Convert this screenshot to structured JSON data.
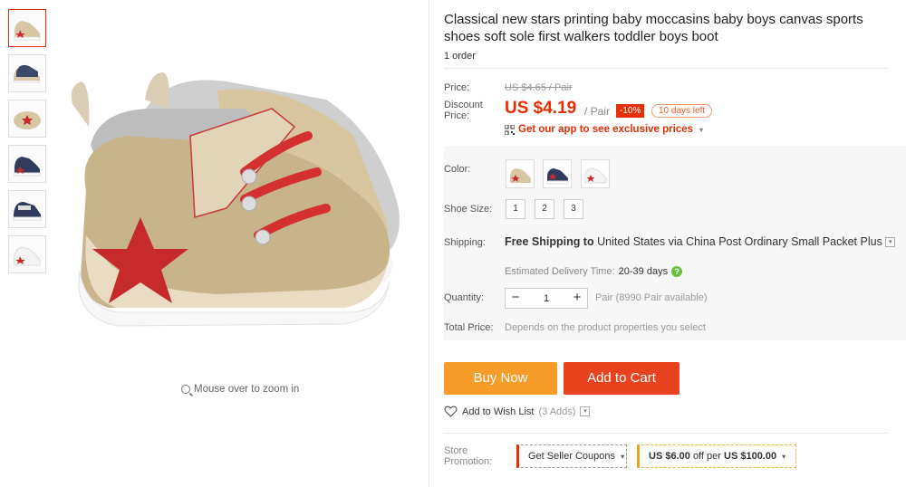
{
  "product": {
    "title": "Classical new stars printing baby moccasins baby boys canvas sports shoes soft sole first walkers toddler boys boot",
    "orders": "1 order"
  },
  "gallery": {
    "zoom_hint": "Mouse over to zoom in",
    "thumbnails": [
      "thumb-1",
      "thumb-2",
      "thumb-3",
      "thumb-4",
      "thumb-5",
      "thumb-6"
    ]
  },
  "price": {
    "label": "Price:",
    "original": "US $4.65 / Pair",
    "discount_label": "Discount Price:",
    "discount_price": "US $4.19",
    "unit": "/ Pair",
    "discount_badge": "-10%",
    "days_left": "10 days left",
    "app_promo": "Get our app to see exclusive prices",
    "app_promo_caret": "▾"
  },
  "options": {
    "color_label": "Color:",
    "size_label": "Shoe Size:",
    "sizes": [
      "1",
      "2",
      "3"
    ]
  },
  "shipping": {
    "label": "Shipping:",
    "free_text": "Free Shipping to",
    "destination": "United States via China Post Ordinary Small Packet Plus",
    "dropdown_glyph": "▾",
    "est_label": "Estimated Delivery Time:",
    "est_days": "20-39 days",
    "help_glyph": "?"
  },
  "quantity": {
    "label": "Quantity:",
    "minus": "−",
    "value": "1",
    "plus": "+",
    "available": "Pair (8990 Pair available)"
  },
  "total": {
    "label": "Total Price:",
    "desc": "Depends on the product properties you select"
  },
  "actions": {
    "buy_now": "Buy Now",
    "add_to_cart": "Add to Cart",
    "wish_list": "Add to Wish List",
    "wish_count": "(3 Adds)",
    "wish_caret": "▾"
  },
  "promotion": {
    "label": "Store Promotion:",
    "coupon": "Get Seller Coupons",
    "coupon_caret": "▾",
    "offer_amount": "US $6.00",
    "offer_mid": "off per",
    "offer_threshold": "US $100.00",
    "offer_caret": "▾"
  },
  "colors": {
    "accent": "#e62e04",
    "buy_now_bg": "#f89c29",
    "add_to_cart_bg": "#e8421f"
  }
}
